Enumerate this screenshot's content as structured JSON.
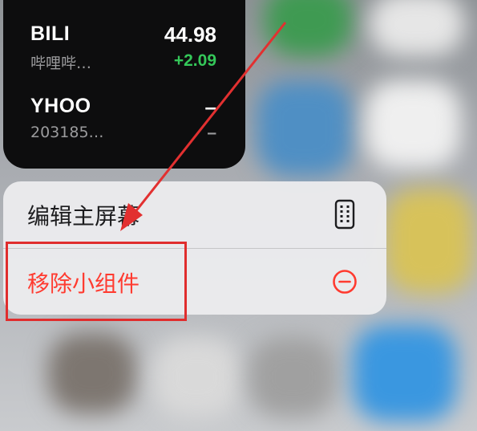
{
  "stock_widget": {
    "rows": [
      {
        "symbol": "BILI",
        "name": "哔哩哔…",
        "price": "44.98",
        "change": "+2.09"
      },
      {
        "symbol": "YHOO",
        "name": "203185…",
        "price": "–",
        "change": "–"
      }
    ]
  },
  "context_menu": {
    "items": [
      {
        "label": "编辑主屏幕",
        "icon": "phone-grid-icon"
      },
      {
        "label": "移除小组件",
        "icon": "minus-circle-icon"
      }
    ]
  },
  "colors": {
    "destructive": "#ff3b30",
    "positive_change": "#34c759",
    "annotation": "#e02d2d"
  }
}
